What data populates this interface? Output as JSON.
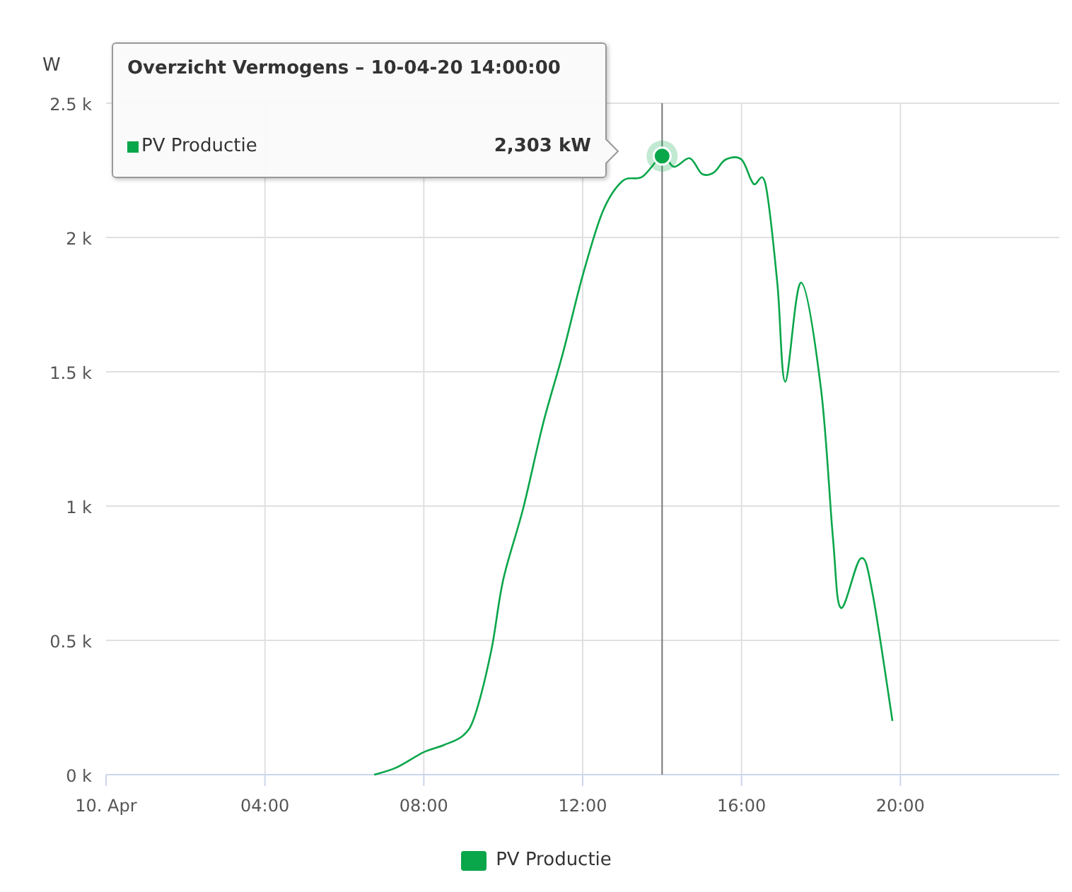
{
  "chart": {
    "chart_data": {
      "type": "line",
      "ylabel": "W",
      "xlim": [
        0,
        24
      ],
      "ylim": [
        0,
        2500
      ],
      "xticks": [
        {
          "value": 0,
          "label": "10. Apr"
        },
        {
          "value": 4,
          "label": "04:00"
        },
        {
          "value": 8,
          "label": "08:00"
        },
        {
          "value": 12,
          "label": "12:00"
        },
        {
          "value": 16,
          "label": "16:00"
        },
        {
          "value": 20,
          "label": "20:00"
        }
      ],
      "yticks": [
        {
          "value": 0,
          "label": "0 k"
        },
        {
          "value": 500,
          "label": "0.5 k"
        },
        {
          "value": 1000,
          "label": "1 k"
        },
        {
          "value": 1500,
          "label": "1.5 k"
        },
        {
          "value": 2000,
          "label": "2 k"
        },
        {
          "value": 2500,
          "label": "2.5 k"
        }
      ],
      "x": [
        6.75,
        7.3,
        8,
        8.5,
        9,
        9.3,
        9.7,
        10,
        10.5,
        11,
        11.5,
        12,
        12.5,
        13,
        13.5,
        14,
        14.3,
        14.7,
        15,
        15.3,
        15.6,
        16,
        16.3,
        16.6,
        16.9,
        17.1,
        17.5,
        18,
        18.3,
        18.5,
        19,
        19.3,
        19.8
      ],
      "series": [
        {
          "name": "PV Productie",
          "color": "#0aa64a",
          "values": [
            0,
            26,
            84,
            110,
            147,
            226,
            463,
            726,
            990,
            1305,
            1568,
            1858,
            2095,
            2210,
            2226,
            2303,
            2263,
            2295,
            2237,
            2242,
            2290,
            2290,
            2200,
            2200,
            1832,
            1463,
            1832,
            1437,
            884,
            621,
            805,
            674,
            200
          ]
        }
      ],
      "grid": true,
      "ref_lines": [
        {
          "axis": "x",
          "value": 14
        }
      ]
    },
    "tooltip": {
      "title": "Overzicht Vermogens – 10-04-20 14:00:00",
      "series_name": "PV Productie",
      "value": "2,303 kW"
    }
  }
}
